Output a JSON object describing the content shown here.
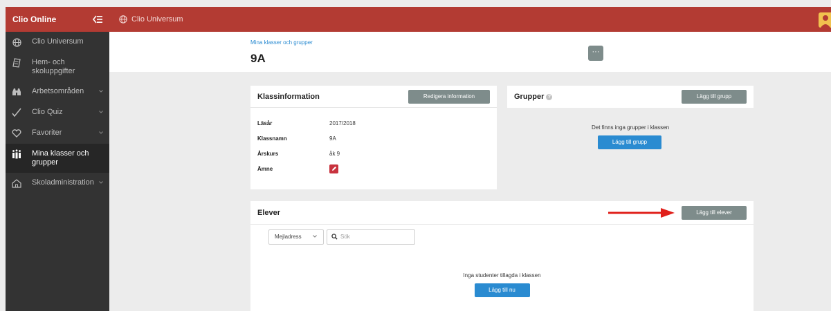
{
  "sidebar": {
    "brand": "Clio Online",
    "items": [
      {
        "label": "Clio Universum",
        "icon": "globe-icon",
        "chevron": false
      },
      {
        "label": "Hem- och skoluppgifter",
        "icon": "notes-icon",
        "chevron": false
      },
      {
        "label": "Arbetsområden",
        "icon": "binoculars-icon",
        "chevron": true
      },
      {
        "label": "Clio Quiz",
        "icon": "check-icon",
        "chevron": true
      },
      {
        "label": "Favoriter",
        "icon": "heart-icon",
        "chevron": true
      },
      {
        "label": "Mina klasser och grupper",
        "icon": "group-icon",
        "chevron": false,
        "active": true
      },
      {
        "label": "Skoladministration",
        "icon": "school-icon",
        "chevron": true
      }
    ]
  },
  "topbar": {
    "title": "Clio Universum"
  },
  "header": {
    "breadcrumb": "Mina klasser och grupper",
    "title": "9A",
    "more_label": "···"
  },
  "klassinfo": {
    "title": "Klassinformation",
    "edit_label": "Redigera information",
    "rows": [
      {
        "label": "Läsår",
        "value": "2017/2018"
      },
      {
        "label": "Klassnamn",
        "value": "9A"
      },
      {
        "label": "Årskurs",
        "value": "åk 9"
      },
      {
        "label": "Ämne",
        "value": ""
      }
    ]
  },
  "grupper": {
    "title": "Grupper",
    "help": "?",
    "add_label": "Lägg till grupp",
    "empty_text": "Det finns inga grupper i klassen",
    "empty_add_label": "Lägg till grupp"
  },
  "elever": {
    "title": "Elever",
    "add_label": "Lägg till elever",
    "filter_value": "Mejladress",
    "search_placeholder": "Sök",
    "empty_text": "Inga studenter tillagda i klassen",
    "empty_add_label": "Lägg till nu"
  },
  "colors": {
    "brand_red": "#b33b33",
    "sidebar_bg": "#333333",
    "accent_blue": "#2a8bd1",
    "grey_button": "#7e8c8b",
    "annotation_arrow": "#e0201b"
  }
}
